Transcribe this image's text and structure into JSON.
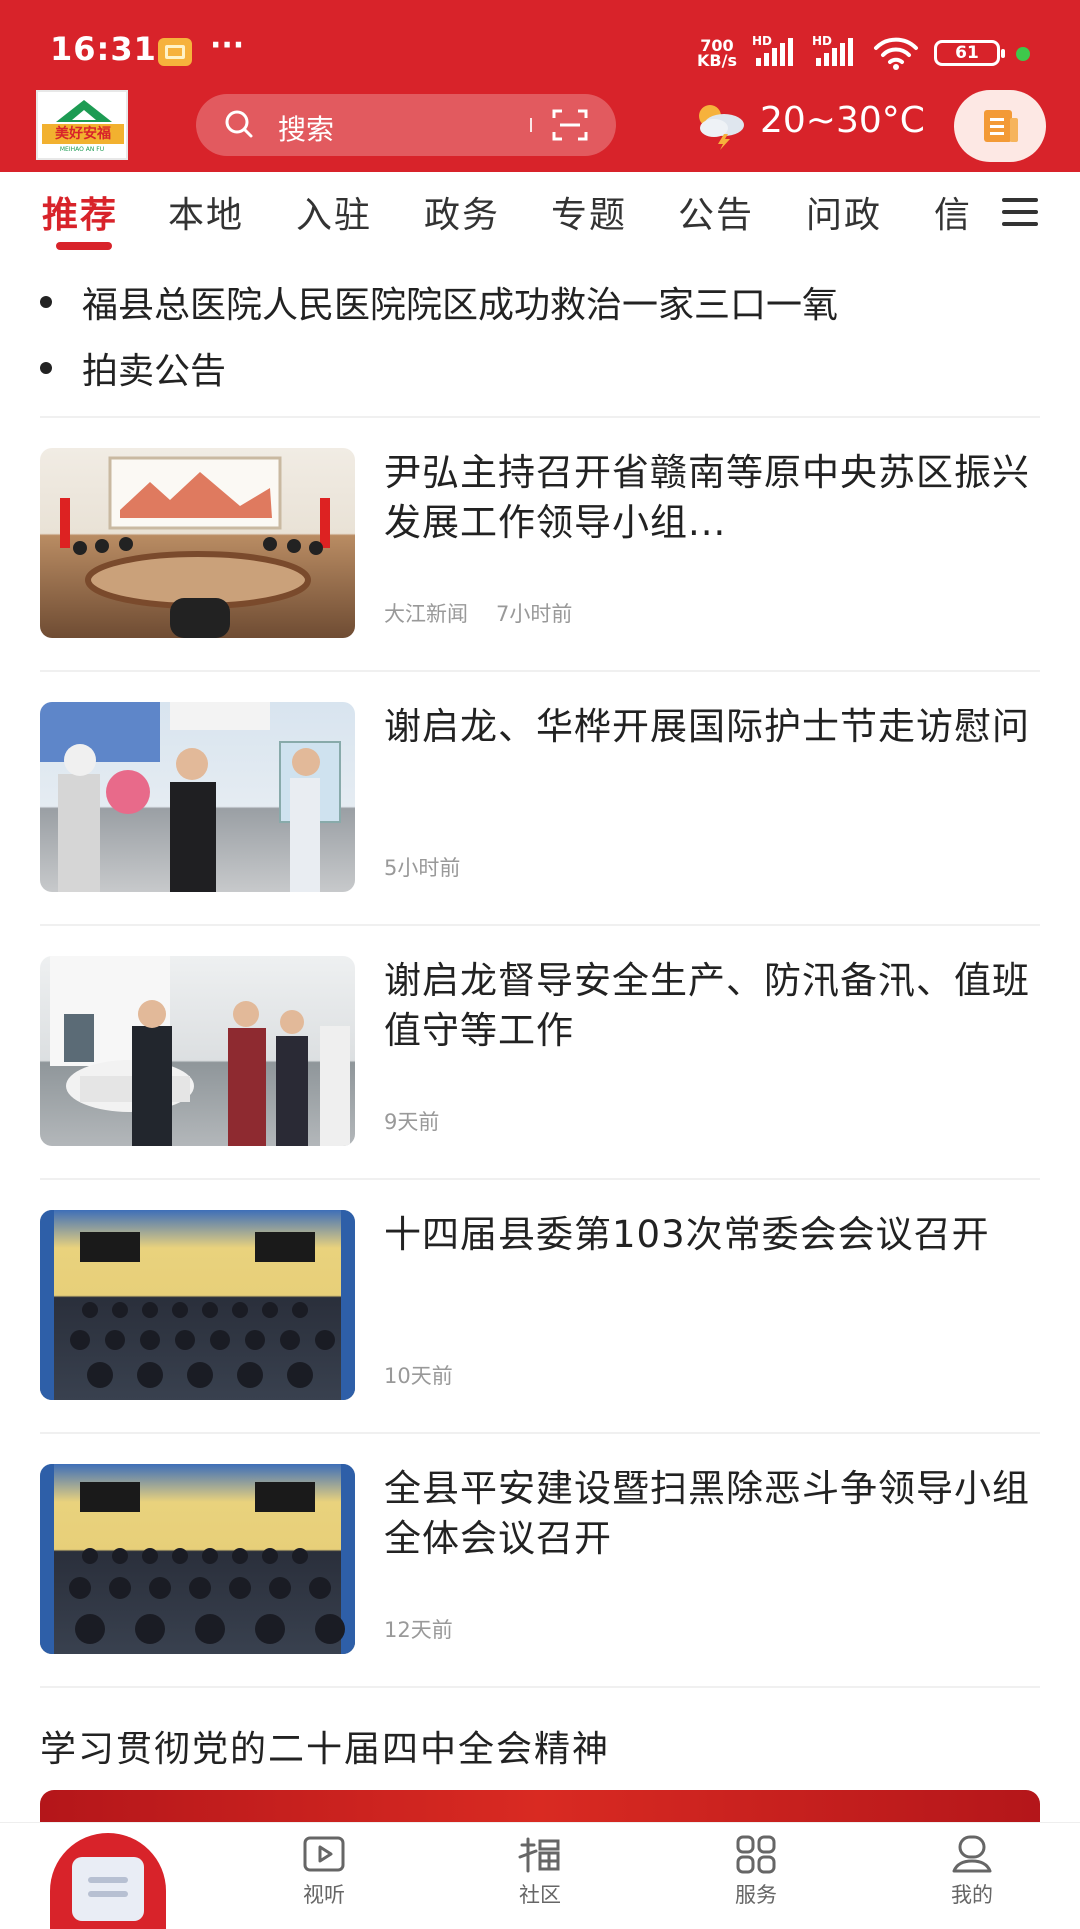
{
  "status_bar": {
    "time": "16:31",
    "more": "···",
    "net_speed_value": "700",
    "net_speed_unit": "KB/s",
    "sim_tag_1": "HD",
    "sim_tag_2": "HD",
    "battery": "61",
    "icons": [
      "message-icon",
      "signal-icon",
      "signal-icon",
      "wifi-icon",
      "battery-icon"
    ]
  },
  "header": {
    "logo_text": "美好安福",
    "logo_subtext": "MEIHAO AN FU",
    "search_placeholder": "搜索",
    "weather": "20~30°C",
    "colors": {
      "brand_red": "#d8232a",
      "logo_green": "#1d9b53",
      "logo_gold": "#f2b12f"
    }
  },
  "tabs": [
    {
      "label": "推荐",
      "active": true
    },
    {
      "label": "本地",
      "active": false
    },
    {
      "label": "入驻",
      "active": false
    },
    {
      "label": "政务",
      "active": false
    },
    {
      "label": "专题",
      "active": false
    },
    {
      "label": "公告",
      "active": false
    },
    {
      "label": "问政",
      "active": false
    },
    {
      "label": "信",
      "active": false
    }
  ],
  "notices": [
    "福县总医院人民医院院区成功救治一家三口一氧",
    "拍卖公告"
  ],
  "news": [
    {
      "title": "尹弘主持召开省赣南等原中央苏区振兴发展工作领导小组...",
      "source": "大江新闻",
      "time": "7小时前"
    },
    {
      "title": "谢启龙、华桦开展国际护士节走访慰问",
      "source": "",
      "time": "5小时前"
    },
    {
      "title": "谢启龙督导安全生产、防汛备汛、值班值守等工作",
      "source": "",
      "time": "9天前"
    },
    {
      "title": "十四届县委第103次常委会会议召开",
      "source": "",
      "time": "10天前"
    },
    {
      "title": "全县平安建设暨扫黑除恶斗争领导小组全体会议召开",
      "source": "",
      "time": "12天前"
    }
  ],
  "section_title": "学习贯彻党的二十届四中全会精神",
  "bottom_nav": [
    {
      "label": "视听",
      "icon": "play-icon"
    },
    {
      "label": "社区",
      "icon": "fu-icon"
    },
    {
      "label": "服务",
      "icon": "grid-icon"
    },
    {
      "label": "我的",
      "icon": "user-icon"
    }
  ]
}
